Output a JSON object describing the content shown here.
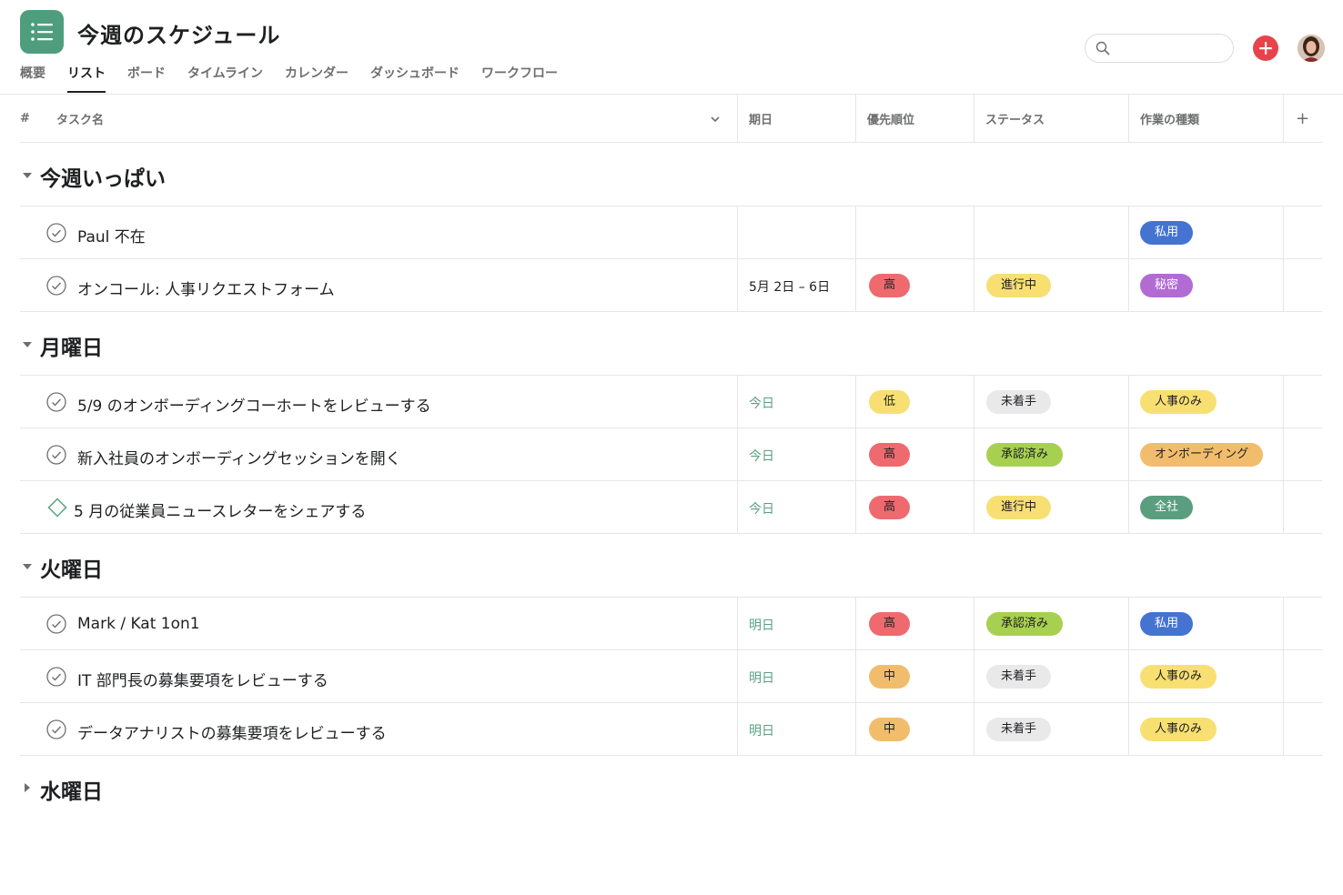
{
  "header": {
    "title": "今週のスケジュール",
    "tabs": [
      "概要",
      "リスト",
      "ボード",
      "タイムライン",
      "カレンダー",
      "ダッシュボード",
      "ワークフロー"
    ],
    "active_tab": "リスト",
    "search_placeholder": ""
  },
  "columns": {
    "hash": "#",
    "task": "タスク名",
    "due": "期日",
    "priority": "優先順位",
    "status": "ステータス",
    "type": "作業の種類",
    "add": "+"
  },
  "sections": [
    {
      "title": "今週いっぱい",
      "expanded": true
    },
    {
      "title": "月曜日",
      "expanded": true
    },
    {
      "title": "火曜日",
      "expanded": true
    },
    {
      "title": "水曜日",
      "expanded": false
    }
  ],
  "rows": [
    {
      "name": "Paul 不在",
      "icon": "check-circle-icon",
      "due": "",
      "priority": "",
      "status": "",
      "type": "私用"
    },
    {
      "name": "オンコール: 人事リクエストフォーム",
      "icon": "check-circle-icon",
      "due": "5月 2日 – 6日",
      "priority": "高",
      "status": "進行中",
      "type": "秘密"
    },
    {
      "name": "5/9 のオンボーディングコーホートをレビューする",
      "icon": "check-circle-icon",
      "due": "今日",
      "priority": "低",
      "status": "未着手",
      "type": "人事のみ"
    },
    {
      "name": "新入社員のオンボーディングセッションを開く",
      "icon": "check-circle-icon",
      "due": "今日",
      "priority": "高",
      "status": "承認済み",
      "type": "オンボーディング"
    },
    {
      "name": "5 月の従業員ニュースレターをシェアする",
      "icon": "milestone-diamond-icon",
      "due": "今日",
      "priority": "高",
      "status": "進行中",
      "type": "全社"
    },
    {
      "name": "Mark / Kat 1on1",
      "icon": "check-circle-icon",
      "due": "明日",
      "priority": "高",
      "status": "承認済み",
      "type": "私用"
    },
    {
      "name": "IT 部門長の募集要項をレビューする",
      "icon": "check-circle-icon",
      "due": "明日",
      "priority": "中",
      "status": "未着手",
      "type": "人事のみ"
    },
    {
      "name": "データアナリストの募集要項をレビューする",
      "icon": "check-circle-icon",
      "due": "明日",
      "priority": "中",
      "status": "未着手",
      "type": "人事のみ"
    }
  ],
  "colors": {
    "app_icon": "#4e9e7e",
    "add_button": "#e8434b",
    "priority_high": "#ee6a6f",
    "priority_low": "#f8df72",
    "priority_medium": "#f1bd6c",
    "status_in_progress": "#f8df72",
    "status_not_started": "#e9e9ea",
    "status_approved": "#a7d050",
    "type_private": "#4573d2",
    "type_secret": "#b36bd4",
    "type_hr_only": "#f8df72",
    "type_onboarding": "#f1bd6c",
    "type_company": "#5a9e7f",
    "date_green": "#58a182"
  }
}
